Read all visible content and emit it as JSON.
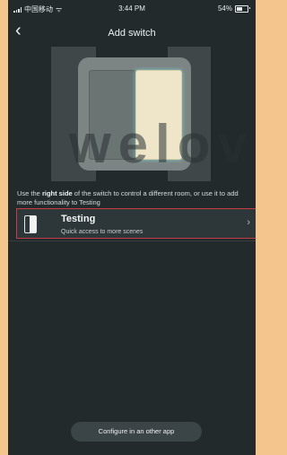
{
  "status_bar": {
    "carrier": "中国移动",
    "time": "3:44 PM",
    "battery_text": "54%",
    "battery_level": 0.54
  },
  "header": {
    "title": "Add switch"
  },
  "hero": {
    "watermark_text": "welov"
  },
  "description": {
    "prefix": "Use the ",
    "bold": "right side",
    "suffix": " of the switch to control a different room, or use it to add more functionality to Testing"
  },
  "room_row": {
    "title": "Testing",
    "subtitle": "Quick access to more scenes"
  },
  "footer": {
    "configure_label": "Configure in an other app"
  },
  "colors": {
    "app_background": "#222a2c",
    "highlight_border": "#c73b43",
    "outer_background": "#f4c58c"
  },
  "icons": {
    "back": "chevron-left-icon",
    "row_icon": "switch-icon",
    "row_chevron": "chevron-right-icon",
    "wifi": "wifi-icon",
    "battery": "battery-icon",
    "signal": "signal-icon"
  }
}
